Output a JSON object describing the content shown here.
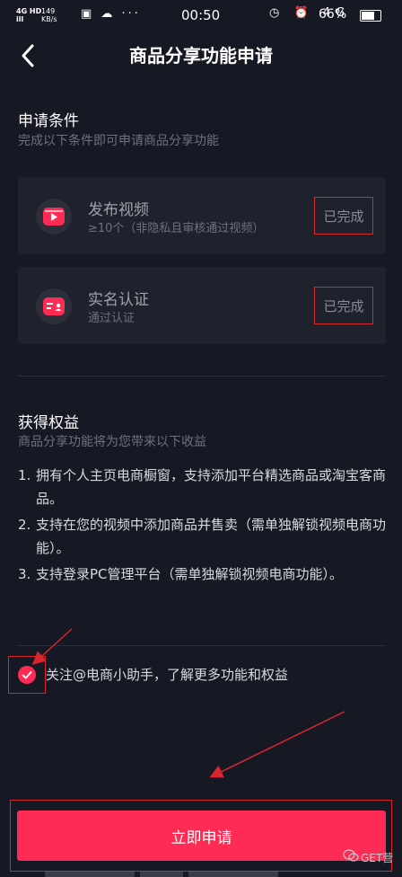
{
  "status_bar": {
    "network": "4G HD",
    "signal_bars": "ill",
    "speed_value": "149",
    "speed_unit": "KB/s",
    "left_icons": "▣ ☁ ···",
    "time": "00:50",
    "right_icons": "◷ ⏰ 4G",
    "battery": "66%"
  },
  "header": {
    "title": "商品分享功能申请"
  },
  "conditions": {
    "title": "申请条件",
    "subtitle": "完成以下条件即可申请商品分享功能",
    "items": [
      {
        "icon": "video-icon",
        "title": "发布视频",
        "desc": "≥10个（非隐私且审核通过视频）",
        "status": "已完成"
      },
      {
        "icon": "id-card-icon",
        "title": "实名认证",
        "desc": "通过认证",
        "status": "已完成"
      }
    ]
  },
  "benefits": {
    "title": "获得权益",
    "subtitle": "商品分享功能将为您带来以下收益",
    "items": [
      {
        "num": "1.",
        "text": "拥有个人主页电商橱窗，支持添加平台精选商品或淘宝客商品。"
      },
      {
        "num": "2.",
        "text": "支持在您的视频中添加商品并售卖（需单独解锁视频电商功能）。"
      },
      {
        "num": "3.",
        "text": "支持登录PC管理平台（需单独解锁视频电商功能）。"
      }
    ]
  },
  "follow": {
    "text": "关注@电商小助手，了解更多功能和权益",
    "checked": true
  },
  "apply_button": {
    "label": "立即申请"
  },
  "watermark": {
    "text": "GET营"
  },
  "colors": {
    "background": "#161823",
    "card": "#1f212c",
    "accent": "#fe2c55",
    "annotation": "#d8262e"
  }
}
